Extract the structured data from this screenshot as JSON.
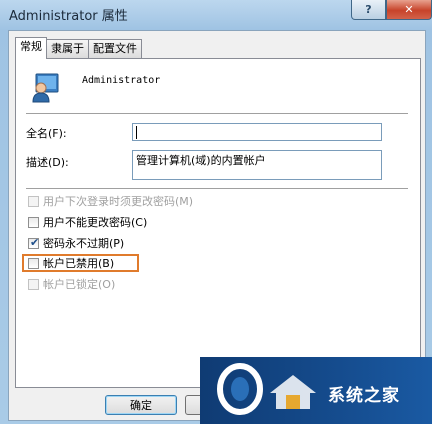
{
  "window": {
    "title": "Administrator 属性",
    "help_glyph": "?",
    "close_glyph": "✕"
  },
  "tabs": [
    {
      "label": "常规"
    },
    {
      "label": "隶属于"
    },
    {
      "label": "配置文件"
    }
  ],
  "user": {
    "name": "Administrator"
  },
  "fields": {
    "fullname_label": "全名(F):",
    "fullname_value": "",
    "description_label": "描述(D):",
    "description_value": "管理计算机(域)的内置帐户"
  },
  "checkboxes": [
    {
      "label": "用户下次登录时须更改密码(M)",
      "checked": false,
      "enabled": false
    },
    {
      "label": "用户不能更改密码(C)",
      "checked": false,
      "enabled": true
    },
    {
      "label": "密码永不过期(P)",
      "checked": true,
      "enabled": true
    },
    {
      "label": "帐户已禁用(B)",
      "checked": false,
      "enabled": true
    },
    {
      "label": "帐户已锁定(O)",
      "checked": false,
      "enabled": false
    }
  ],
  "buttons": {
    "ok": "确定"
  },
  "watermark": {
    "text": "系统之家"
  },
  "colors": {
    "highlight": "#e07b2c",
    "title_bg": "#a9cbe7"
  }
}
